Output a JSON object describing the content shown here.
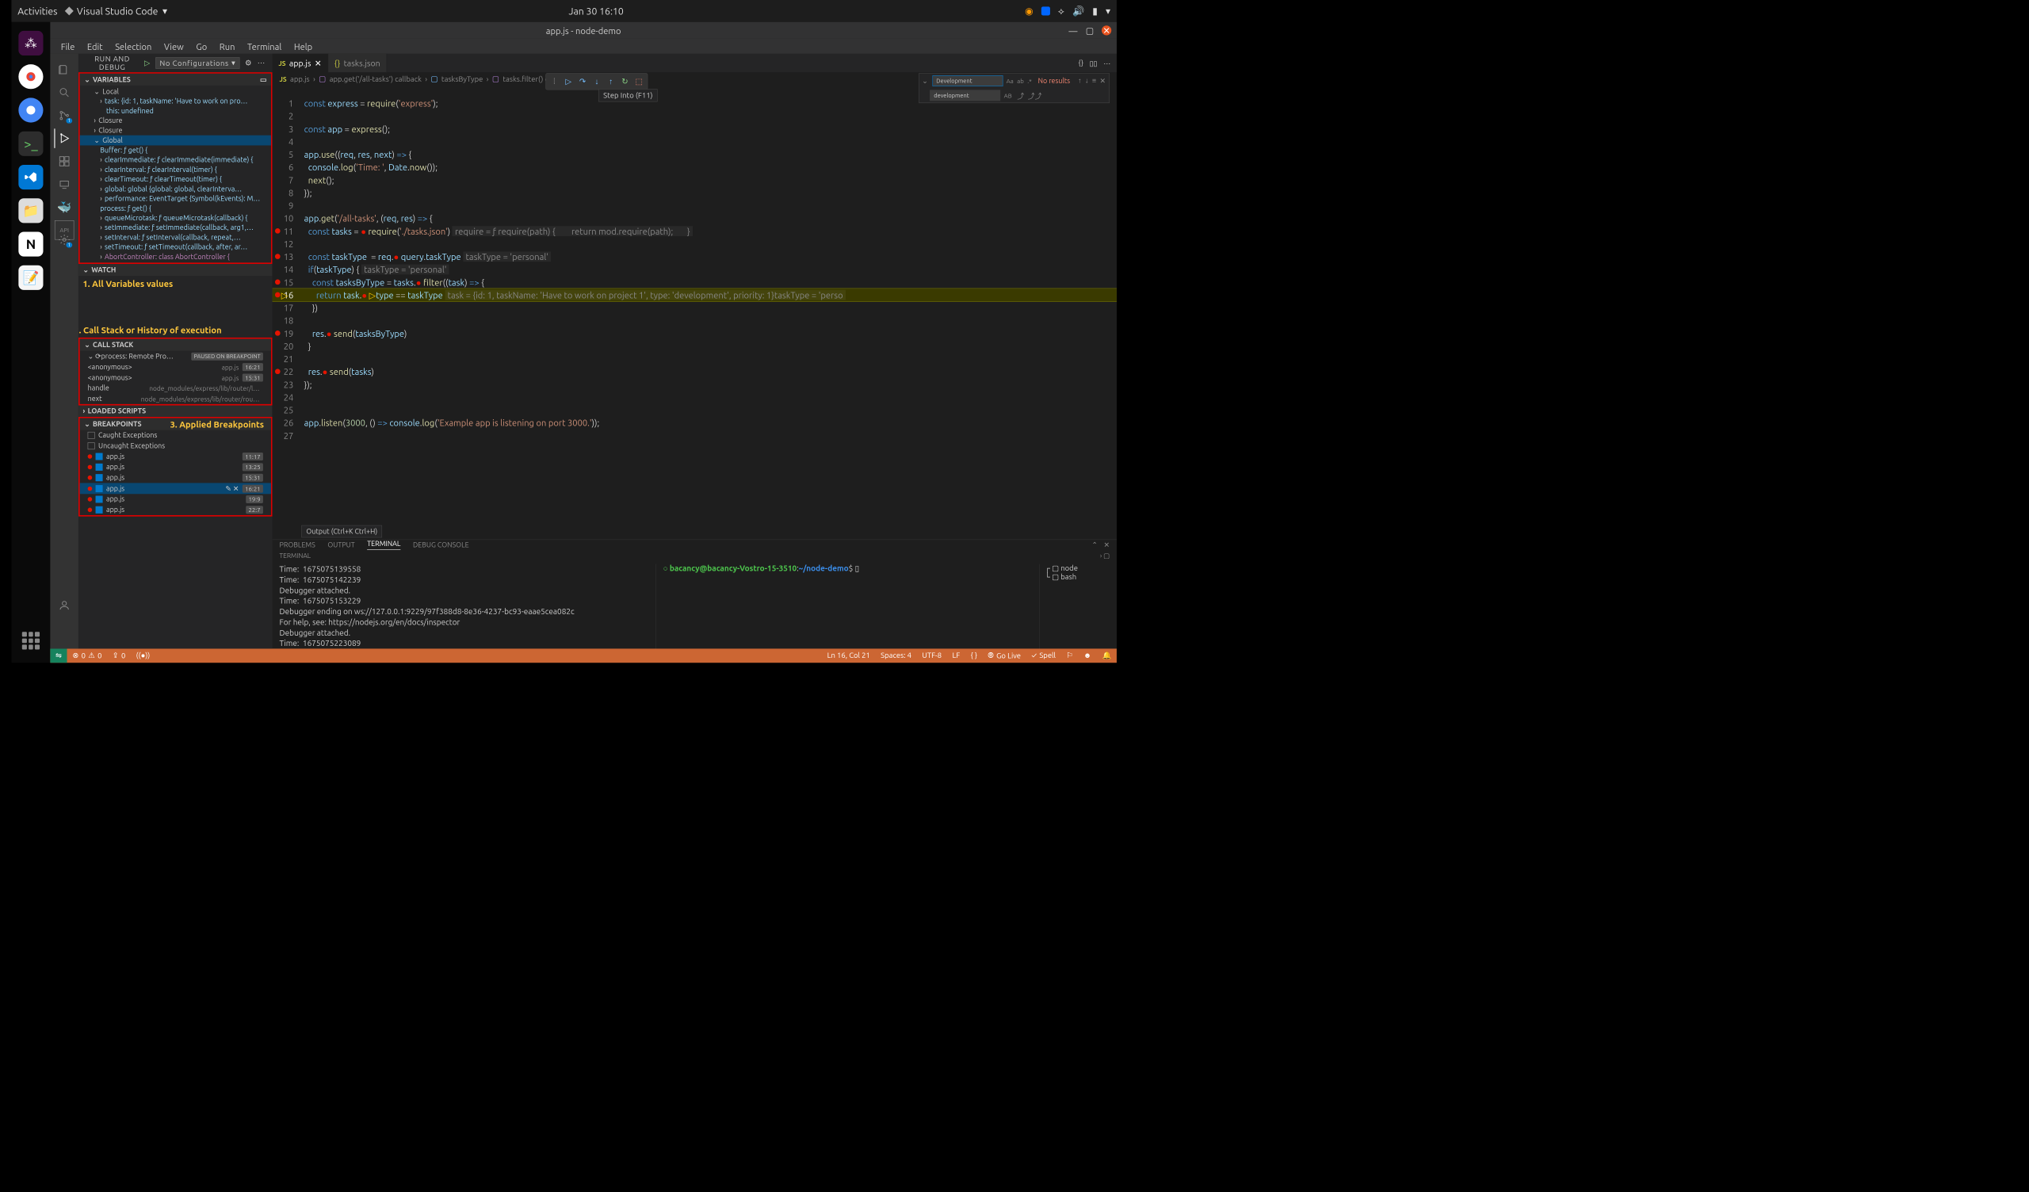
{
  "topbar": {
    "activities": "Activities",
    "app": "Visual Studio Code",
    "clock": "Jan 30  16:10"
  },
  "window": {
    "title": "app.js - node-demo"
  },
  "menubar": [
    "File",
    "Edit",
    "Selection",
    "View",
    "Go",
    "Run",
    "Terminal",
    "Help"
  ],
  "runDebug": {
    "title": "RUN AND DEBUG",
    "config": "No Configurations"
  },
  "variables": {
    "title": "VARIABLES",
    "local": "Local",
    "task": "task: {id: 1, taskName: 'Have to work on pro…",
    "this": "this: undefined",
    "closure1": "Closure",
    "closure2": "Closure",
    "global": "Global",
    "rows": [
      "Buffer:    ƒ get() {",
      "clearImmediate: ƒ clearImmediate(immediate) {",
      "clearInterval: ƒ clearInterval(timer) {",
      "clearTimeout: ƒ clearTimeout(timer) {",
      "global: global {global: global, clearInterva…",
      "performance: EventTarget {Symbol(kEvents): M…",
      "process:   ƒ get() {",
      "queueMicrotask: ƒ queueMicrotask(callback) {",
      "setImmediate: ƒ setImmediate(callback, arg1,…",
      "setInterval: ƒ setInterval(callback, repeat,…",
      "setTimeout: ƒ setTimeout(callback, after, ar…",
      "AbortController: class AbortController {"
    ]
  },
  "annotations": {
    "a1": "1. All Variables values",
    "a2": "2. Call Stack or History of execution",
    "a3": "3. Applied Breakpoints"
  },
  "watch": {
    "title": "WATCH"
  },
  "callstack": {
    "title": "CALL STACK",
    "process": "process: Remote Pro…",
    "badge": "PAUSED ON BREAKPOINT",
    "rows": [
      {
        "name": "<anonymous>",
        "file": "app.js",
        "loc": "16:21"
      },
      {
        "name": "<anonymous>",
        "file": "app.js",
        "loc": "15:31"
      },
      {
        "name": "handle",
        "file": "node_modules/express/lib/router/l…",
        "loc": ""
      },
      {
        "name": "next",
        "file": "node_modules/express/lib/router/rou…",
        "loc": ""
      }
    ]
  },
  "loadedScripts": {
    "title": "LOADED SCRIPTS"
  },
  "breakpoints": {
    "title": "BREAKPOINTS",
    "caught": "Caught Exceptions",
    "uncaught": "Uncaught Exceptions",
    "rows": [
      {
        "f": "app.js",
        "loc": "11:17"
      },
      {
        "f": "app.js",
        "loc": "13:25"
      },
      {
        "f": "app.js",
        "loc": "15:31"
      },
      {
        "f": "app.js",
        "loc": "16:21",
        "sel": true
      },
      {
        "f": "app.js",
        "loc": "19:9"
      },
      {
        "f": "app.js",
        "loc": "22:7"
      }
    ]
  },
  "tabs": {
    "t1": "app.js",
    "t2": "tasks.json"
  },
  "breadcrumb": [
    "app.js",
    "app.get('/all-tasks') callback",
    "tasksByType",
    "tasks.filter() ca…"
  ],
  "debugToolbar": {
    "tooltip": "Step Into (F11)"
  },
  "find": {
    "value": "Development",
    "results": "No results",
    "replace": "development"
  },
  "code": {
    "l1": "const express = require('express');",
    "l3": "const app = express();",
    "l5": "app.use((req, res, next) => {",
    "l6": "  console.log('Time: ', Date.now());",
    "l7": "  next();",
    "l8": "});",
    "l10": "app.get('/all-tasks', (req, res) => {",
    "l11": "  const tasks = ● require('./tasks.json')",
    "l11i": "require = ƒ require(path) {        return mod.require(path);       }",
    "l13": "  const taskType  = req.● query.taskType",
    "l13i": "taskType = 'personal'",
    "l14": "  if(taskType) {",
    "l14i": "taskType = 'personal'",
    "l15": "    const tasksByType = tasks.● filter((task) => {",
    "l16": "      return task.● ▷type == taskType",
    "l16i": "task = {id: 1, taskName: 'Have to work on project 1', type: 'development', priority: 1}taskType = 'perso",
    "l17": "    })",
    "l19": "    res.● send(tasksByType)",
    "l20": "  }",
    "l22": "  res.● send(tasks)",
    "l23": "});",
    "l26": "app.listen(3000, () => console.log('Example app is listening on port 3000.'));"
  },
  "outputTip": "Output (Ctrl+K Ctrl+H)",
  "panel": {
    "tabs": [
      "PROBLEMS",
      "OUTPUT",
      "TERMINAL",
      "DEBUG CONSOLE"
    ],
    "subLeft": "TERMINAL",
    "termLeft": "Time:  1675075139558\nTime:  1675075142239\nDebugger attached.\nTime:  1675075153229\nDebugger ending on ws://127.0.0.1:9229/97f388d8-8e36-4237-bc93-eaae5cea082c\nFor help, see: https://nodejs.org/en/docs/inspector\nDebugger attached.\nTime:  1675075223089\n▮",
    "promptUser": "bacancy@bacancy-Vostro-15-3510",
    "promptPath": "~/node-demo",
    "promptEnd": "$",
    "termList": [
      "node",
      "bash"
    ]
  },
  "statusbar": {
    "errors": "0",
    "warnings": "0",
    "port": "0",
    "pos": "Ln 16, Col 21",
    "spaces": "Spaces: 4",
    "enc": "UTF-8",
    "eol": "LF",
    "lang": "{ }",
    "golive": "Go Live",
    "spell": "Spell"
  }
}
